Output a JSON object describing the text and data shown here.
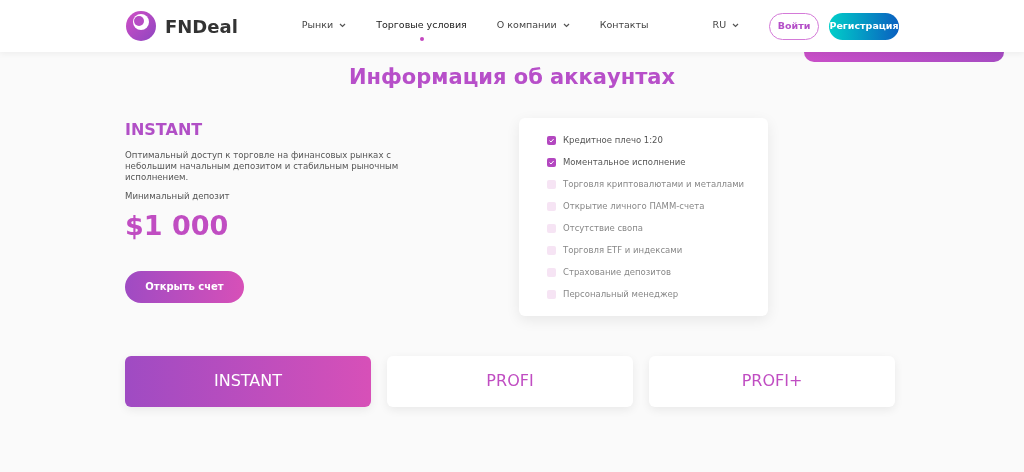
{
  "header": {
    "logo": "FNDeal",
    "nav": [
      {
        "label": "Рынки",
        "dropdown": true,
        "selected": false
      },
      {
        "label": "Торговые условия",
        "dropdown": false,
        "selected": true
      },
      {
        "label": "О компании",
        "dropdown": true,
        "selected": false
      },
      {
        "label": "Контакты",
        "dropdown": false,
        "selected": false
      }
    ],
    "language": "RU",
    "login": "Войти",
    "register": "Регистрация"
  },
  "title": "Информация об аккаунтах",
  "account": {
    "name": "INSTANT",
    "description": "Оптимальный доступ к торговле на финансовых рынках с небольшим начальным депозитом и стабильным рыночным исполнением.",
    "deposit_label": "Минимальный депозит",
    "deposit": "$1 000",
    "button": "Открыть счет"
  },
  "features": [
    {
      "label": "Кредитное плечо 1:20",
      "checked": true
    },
    {
      "label": "Моментальное исполнение",
      "checked": true
    },
    {
      "label": "Торговля криптовалютами и металлами",
      "checked": false
    },
    {
      "label": "Открытие личного ПАММ-счета",
      "checked": false
    },
    {
      "label": "Отсутствие свопа",
      "checked": false
    },
    {
      "label": "Торговля ETF и индексами",
      "checked": false
    },
    {
      "label": "Страхование депозитов",
      "checked": false
    },
    {
      "label": "Персональный менеджер",
      "checked": false
    }
  ],
  "tabs": [
    {
      "label": "INSTANT",
      "selected": true
    },
    {
      "label": "PROFI",
      "selected": false
    },
    {
      "label": "PROFI+",
      "selected": false
    }
  ]
}
